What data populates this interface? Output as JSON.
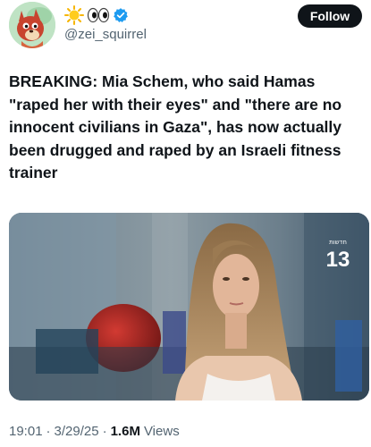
{
  "user": {
    "handle": "@zei_squirrel",
    "name_emojis": [
      "sun",
      "eyes",
      "verified"
    ]
  },
  "follow_button": {
    "label": "Follow"
  },
  "tweet": {
    "text": "BREAKING: Mia Schem, who said Hamas \"raped her with their eyes\" and \"there are no innocent civilians in Gaza\", has now actually been drugged and raped by an Israeli fitness trainer"
  },
  "media": {
    "channel_logo_text": "חדשות",
    "channel_number": "13"
  },
  "meta": {
    "time": "19:01",
    "separator": "·",
    "date": "3/29/25",
    "views_count": "1.6M",
    "views_label": "Views"
  },
  "colors": {
    "text": "#0f1419",
    "secondary": "#536471",
    "verified": "#1d9bf0",
    "follow_bg": "#0f1419"
  }
}
